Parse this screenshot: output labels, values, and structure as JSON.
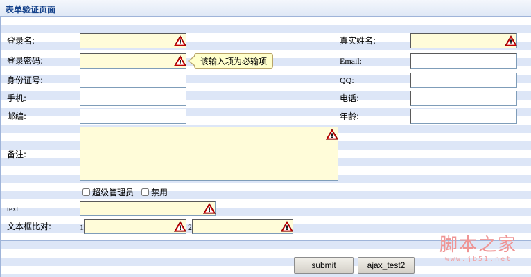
{
  "page": {
    "title": "表单验证页面"
  },
  "form": {
    "login_name": {
      "label": "登录名:",
      "value": "",
      "required": true
    },
    "login_password": {
      "label": "登录密码:",
      "value": "",
      "required": true
    },
    "id_number": {
      "label": "身份证号:",
      "value": ""
    },
    "mobile": {
      "label": "手机:",
      "value": ""
    },
    "postcode": {
      "label": "邮编:",
      "value": ""
    },
    "real_name": {
      "label": "真实姓名:",
      "value": "",
      "required": true
    },
    "email": {
      "label": "Email:",
      "value": ""
    },
    "qq": {
      "label": "QQ:",
      "value": ""
    },
    "phone": {
      "label": "电话:",
      "value": ""
    },
    "age": {
      "label": "年龄:",
      "value": ""
    },
    "remark": {
      "label": "备注:",
      "value": "",
      "required": true
    },
    "checkbox_admin": {
      "label": "超级管理员",
      "checked": false
    },
    "checkbox_disabled": {
      "label": "禁用",
      "checked": false
    },
    "text_field": {
      "label": "text",
      "value": "",
      "required": true
    },
    "compare": {
      "label": "文本框比对:",
      "prefix1": "1",
      "prefix2": "2",
      "value1": "",
      "value2": ""
    }
  },
  "tooltip": {
    "text": "该输入项为必输项"
  },
  "buttons": {
    "submit": "submit",
    "ajax": "ajax_test2"
  },
  "watermark": {
    "brand": "脚本之家",
    "url": "www.jb51.net"
  },
  "colors": {
    "required_bg": "#fffcd9",
    "stripe": "#dde6f7",
    "title_text": "#15428b",
    "warning_red": "#d40000"
  }
}
